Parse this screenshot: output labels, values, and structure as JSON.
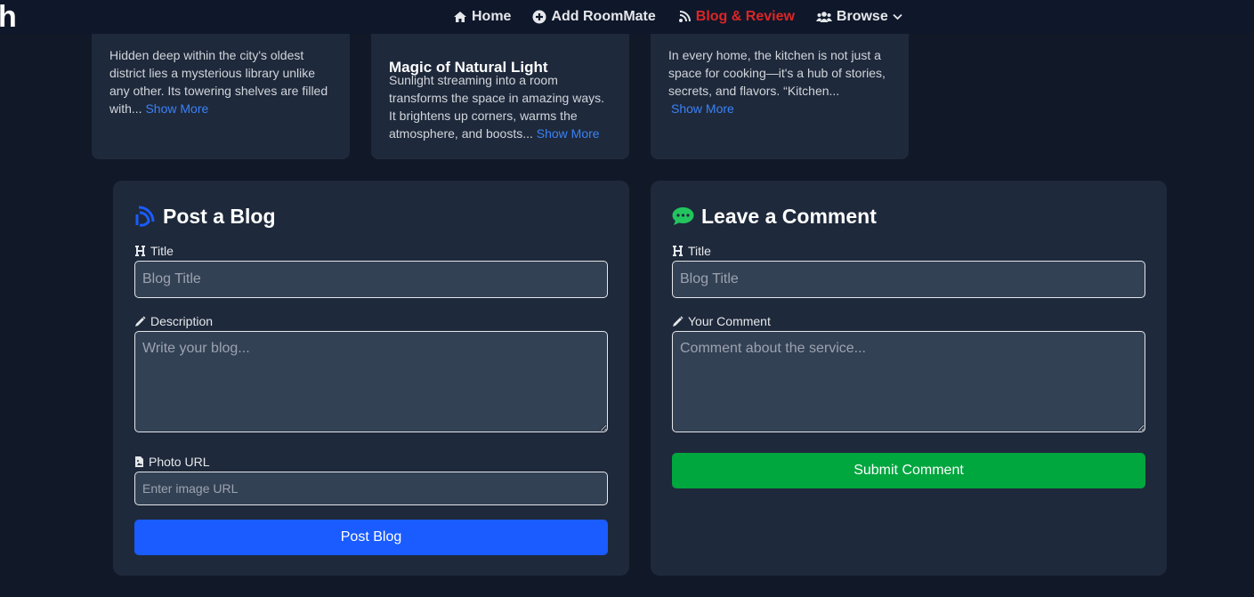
{
  "navbar": {
    "brand": "h",
    "links": [
      {
        "label": "Home",
        "icon": "home-icon"
      },
      {
        "label": "Add RoomMate",
        "icon": "plus-circle-icon"
      },
      {
        "label": "Blog & Review",
        "icon": "blog-rss-icon",
        "active": true
      },
      {
        "label": "Browse",
        "icon": "users-icon"
      }
    ],
    "active_color": "#dc2626"
  },
  "blog_cards": [
    {
      "title": "",
      "text": "Hidden deep within the city's oldest district lies a mysterious library unlike any other. Its towering shelves are filled with...",
      "show_more": "Show More"
    },
    {
      "title": "Magic of Natural Light",
      "text": "Sunlight streaming into a room transforms the space in amazing ways. It brightens up corners, warms the atmosphere, and boosts...",
      "show_more": "Show More"
    },
    {
      "title": "",
      "text": "In every home, the kitchen is not just a space for cooking—it's a hub of stories, secrets, and flavors. “Kitchen...",
      "show_more": "Show More"
    }
  ],
  "post_blog": {
    "heading": "Post a Blog",
    "title_label": "Title",
    "title_placeholder": "Blog Title",
    "description_label": "Description",
    "description_placeholder": "Write your blog...",
    "photo_label": "Photo URL",
    "photo_placeholder": "Enter image URL",
    "submit_label": "Post Blog"
  },
  "comment": {
    "heading": "Leave a Comment",
    "title_label": "Title",
    "title_placeholder": "Blog Title",
    "comment_label": "Your Comment",
    "comment_placeholder": "Comment about the service...",
    "submit_label": "Submit Comment"
  },
  "colors": {
    "page_bg": "#111827",
    "card_bg": "#1e293b",
    "primary_button": "#1a5cff",
    "success_button": "#00a63e",
    "link": "#3b82f6",
    "comment_icon": "#22c55e"
  }
}
